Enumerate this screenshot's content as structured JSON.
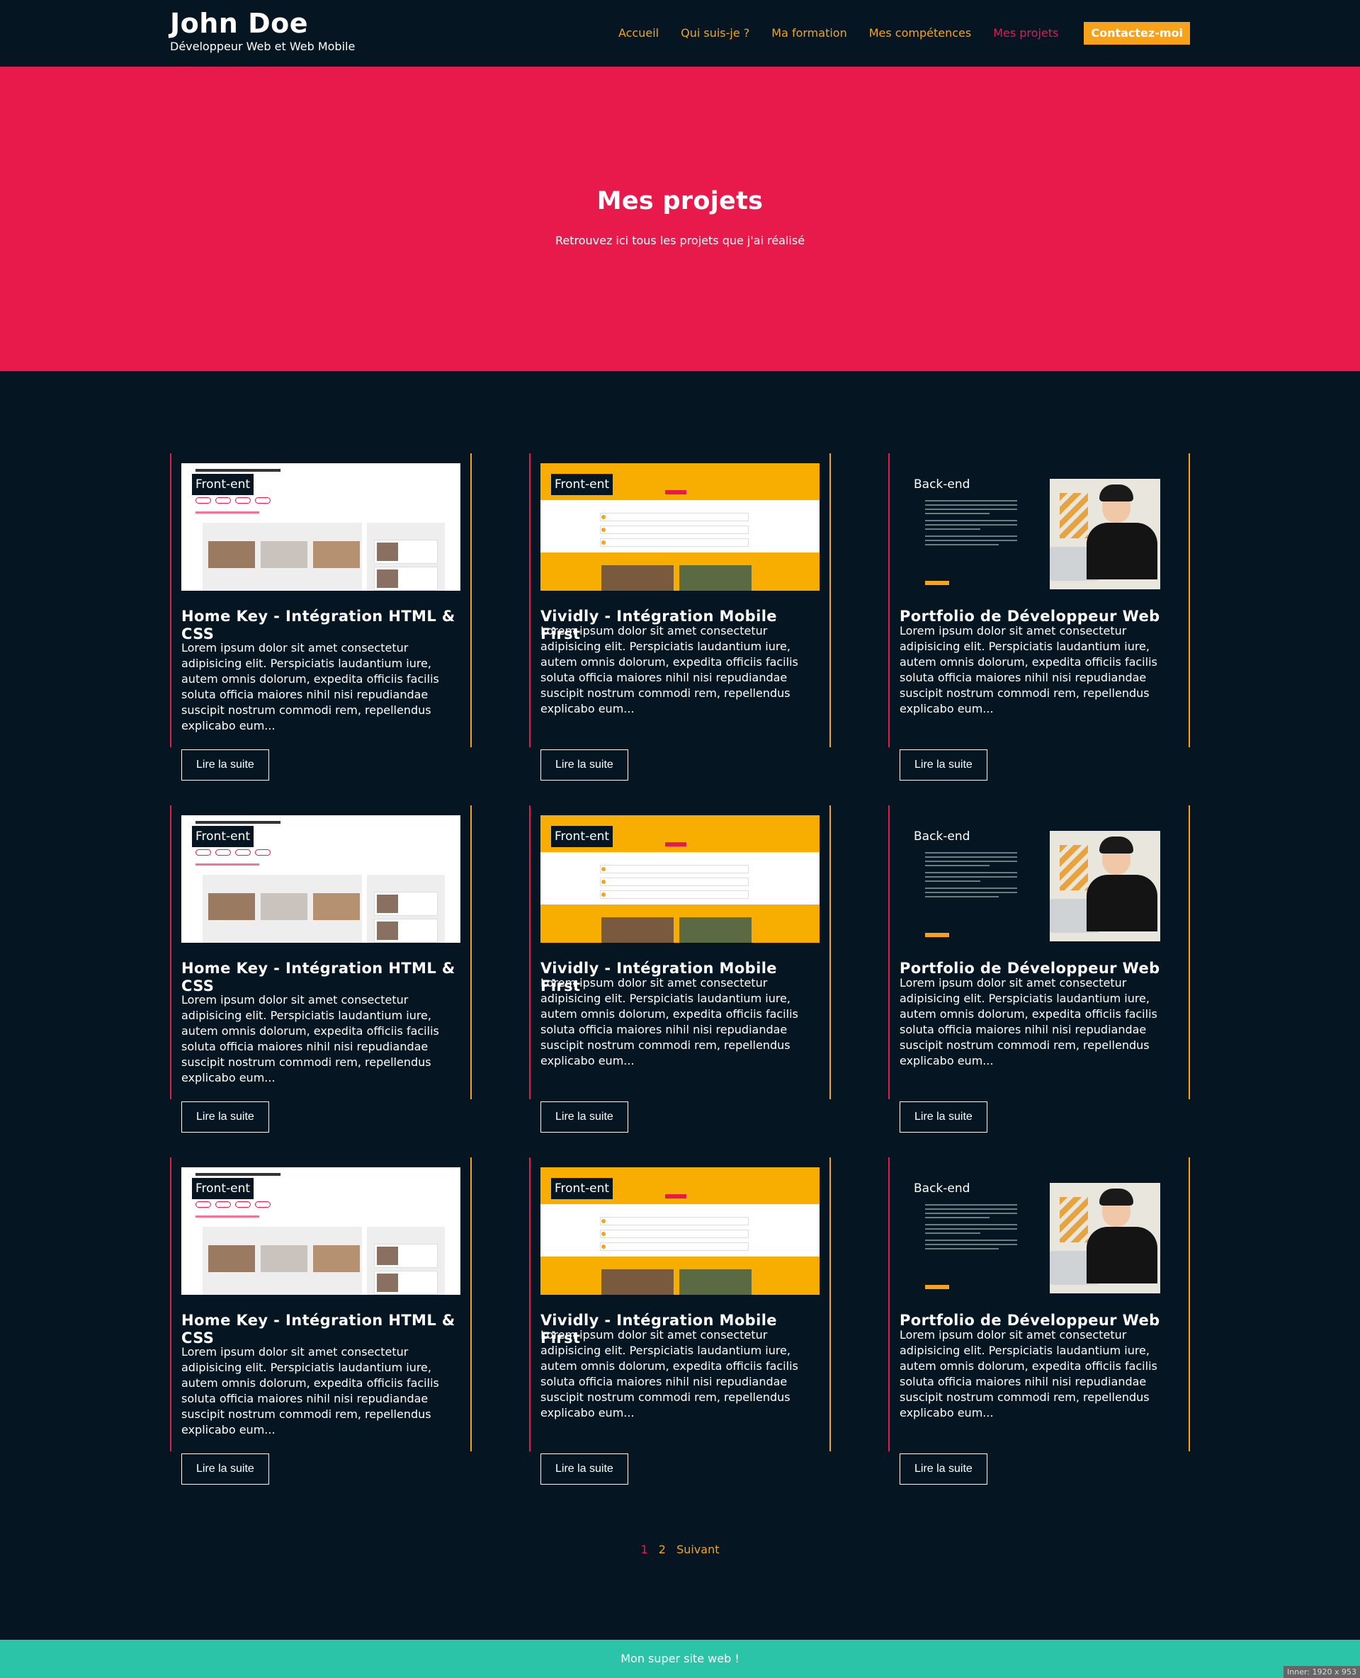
{
  "header": {
    "name": "John Doe",
    "subtitle": "Développeur Web et Web Mobile",
    "nav": [
      {
        "label": "Accueil"
      },
      {
        "label": "Qui suis-je ?"
      },
      {
        "label": "Ma formation"
      },
      {
        "label": "Mes compétences"
      },
      {
        "label": "Mes projets"
      }
    ],
    "cta": "Contactez-moi"
  },
  "hero": {
    "title": "Mes projets",
    "text": "Retrouvez ici tous les projets que j'ai réalisé"
  },
  "projects": [
    {
      "badge": "Front-ent",
      "title": "Home Key - Intégration HTML & CSS",
      "text": "Lorem ipsum dolor sit amet consectetur adipisicing elit. Perspiciatis laudantium iure, autem omnis dolorum, expedita officiis facilis soluta officia maiores nihil nisi repudiandae suscipit nostrum commodi rem, repellendus explicabo eum...",
      "button": "Lire la suite"
    },
    {
      "badge": "Front-ent",
      "title": "Vividly - Intégration Mobile First",
      "text": "Lorem ipsum dolor sit amet consectetur adipisicing elit. Perspiciatis laudantium iure, autem omnis dolorum, expedita officiis facilis soluta officia maiores nihil nisi repudiandae suscipit nostrum commodi rem, repellendus explicabo eum...",
      "button": "Lire la suite"
    },
    {
      "badge": "Back-end",
      "title": "Portfolio de Développeur Web",
      "text": "Lorem ipsum dolor sit amet consectetur adipisicing elit. Perspiciatis laudantium iure, autem omnis dolorum, expedita officiis facilis soluta officia maiores nihil nisi repudiandae suscipit nostrum commodi rem, repellendus explicabo eum...",
      "button": "Lire la suite"
    },
    {
      "badge": "Front-ent",
      "title": "Home Key - Intégration HTML & CSS",
      "text": "Lorem ipsum dolor sit amet consectetur adipisicing elit. Perspiciatis laudantium iure, autem omnis dolorum, expedita officiis facilis soluta officia maiores nihil nisi repudiandae suscipit nostrum commodi rem, repellendus explicabo eum...",
      "button": "Lire la suite"
    },
    {
      "badge": "Front-ent",
      "title": "Vividly - Intégration Mobile First",
      "text": "Lorem ipsum dolor sit amet consectetur adipisicing elit. Perspiciatis laudantium iure, autem omnis dolorum, expedita officiis facilis soluta officia maiores nihil nisi repudiandae suscipit nostrum commodi rem, repellendus explicabo eum...",
      "button": "Lire la suite"
    },
    {
      "badge": "Back-end",
      "title": "Portfolio de Développeur Web",
      "text": "Lorem ipsum dolor sit amet consectetur adipisicing elit. Perspiciatis laudantium iure, autem omnis dolorum, expedita officiis facilis soluta officia maiores nihil nisi repudiandae suscipit nostrum commodi rem, repellendus explicabo eum...",
      "button": "Lire la suite"
    },
    {
      "badge": "Front-ent",
      "title": "Home Key - Intégration HTML & CSS",
      "text": "Lorem ipsum dolor sit amet consectetur adipisicing elit. Perspiciatis laudantium iure, autem omnis dolorum, expedita officiis facilis soluta officia maiores nihil nisi repudiandae suscipit nostrum commodi rem, repellendus explicabo eum...",
      "button": "Lire la suite"
    },
    {
      "badge": "Front-ent",
      "title": "Vividly - Intégration Mobile First",
      "text": "Lorem ipsum dolor sit amet consectetur adipisicing elit. Perspiciatis laudantium iure, autem omnis dolorum, expedita officiis facilis soluta officia maiores nihil nisi repudiandae suscipit nostrum commodi rem, repellendus explicabo eum...",
      "button": "Lire la suite"
    },
    {
      "badge": "Back-end",
      "title": "Portfolio de Développeur Web",
      "text": "Lorem ipsum dolor sit amet consectetur adipisicing elit. Perspiciatis laudantium iure, autem omnis dolorum, expedita officiis facilis soluta officia maiores nihil nisi repudiandae suscipit nostrum commodi rem, repellendus explicabo eum...",
      "button": "Lire la suite"
    }
  ],
  "pagination": {
    "current": "1",
    "page2": "2",
    "next": "Suivant"
  },
  "footer": {
    "text": "Mon super site web !"
  },
  "viewport_tag": "Inner: 1920 x 953",
  "colors": {
    "background": "#051622",
    "accent_red": "#e8194b",
    "accent_orange": "#f8a21a",
    "footer": "#2bc4a9"
  }
}
